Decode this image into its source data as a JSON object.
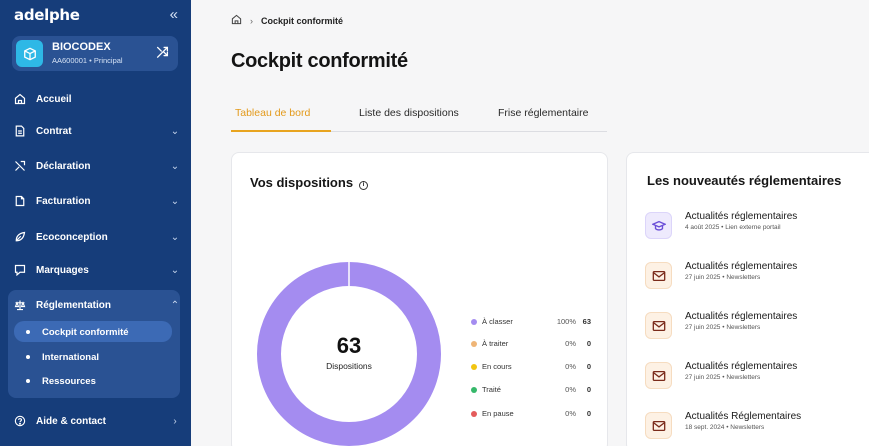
{
  "sidebar": {
    "logo": "adelphe",
    "collapse_glyph": "«",
    "org": {
      "name": "BIOCODEX",
      "sub": "AA600001 • Principal"
    },
    "items": [
      {
        "label": "Accueil",
        "icon": "home-icon"
      },
      {
        "label": "Contrat",
        "icon": "document-icon"
      },
      {
        "label": "Déclaration",
        "icon": "declaration-icon"
      },
      {
        "label": "Facturation",
        "icon": "invoice-icon"
      },
      {
        "label": "Ecoconception",
        "icon": "leaf-icon"
      },
      {
        "label": "Marquages",
        "icon": "tag-icon"
      },
      {
        "label": "Réglementation",
        "icon": "scale-icon"
      },
      {
        "label": "Aide & contact",
        "icon": "help-icon"
      }
    ],
    "sub_items": [
      {
        "label": "Cockpit conformité",
        "active": true
      },
      {
        "label": "International",
        "active": false
      },
      {
        "label": "Ressources",
        "active": false
      }
    ]
  },
  "breadcrumb": {
    "current": "Cockpit conformité"
  },
  "page": {
    "title": "Cockpit conformité"
  },
  "tabs": [
    {
      "label": "Tableau de bord",
      "active": true
    },
    {
      "label": "Liste des dispositions",
      "active": false
    },
    {
      "label": "Frise réglementaire",
      "active": false
    }
  ],
  "dispositions": {
    "title": "Vos dispositions",
    "total": "63",
    "total_label": "Dispositions",
    "legend": [
      {
        "label": "À classer",
        "percent": "100%",
        "value": "63",
        "color": "#a48cf0",
        "fraction": 1.0
      },
      {
        "label": "À traiter",
        "percent": "0%",
        "value": "0",
        "color": "#efb577",
        "fraction": 0
      },
      {
        "label": "En cours",
        "percent": "0%",
        "value": "0",
        "color": "#f2c511",
        "fraction": 0
      },
      {
        "label": "Traité",
        "percent": "0%",
        "value": "0",
        "color": "#36b86a",
        "fraction": 0
      },
      {
        "label": "En pause",
        "percent": "0%",
        "value": "0",
        "color": "#e45b5b",
        "fraction": 0
      }
    ]
  },
  "news": {
    "title": "Les nouveautés réglementaires",
    "items": [
      {
        "title": "Actualités réglementaires",
        "date": "4 août 2025",
        "source": "Lien externe portail",
        "icon": "graduation-cap-icon",
        "tone": "purple"
      },
      {
        "title": "Actualités réglementaires",
        "date": "27 juin 2025",
        "source": "Newsletters",
        "icon": "mail-icon",
        "tone": "orange"
      },
      {
        "title": "Actualités réglementaires",
        "date": "27 juin 2025",
        "source": "Newsletters",
        "icon": "mail-icon",
        "tone": "orange"
      },
      {
        "title": "Actualités réglementaires",
        "date": "27 juin 2025",
        "source": "Newsletters",
        "icon": "mail-icon",
        "tone": "orange"
      },
      {
        "title": "Actualités Réglementaires",
        "date": "18 sept. 2024",
        "source": "Newsletters",
        "icon": "mail-icon",
        "tone": "orange"
      }
    ]
  },
  "colors": {
    "sidebar": "#163d7a",
    "accent": "#e8a41f",
    "donut": "#a48cf0"
  }
}
